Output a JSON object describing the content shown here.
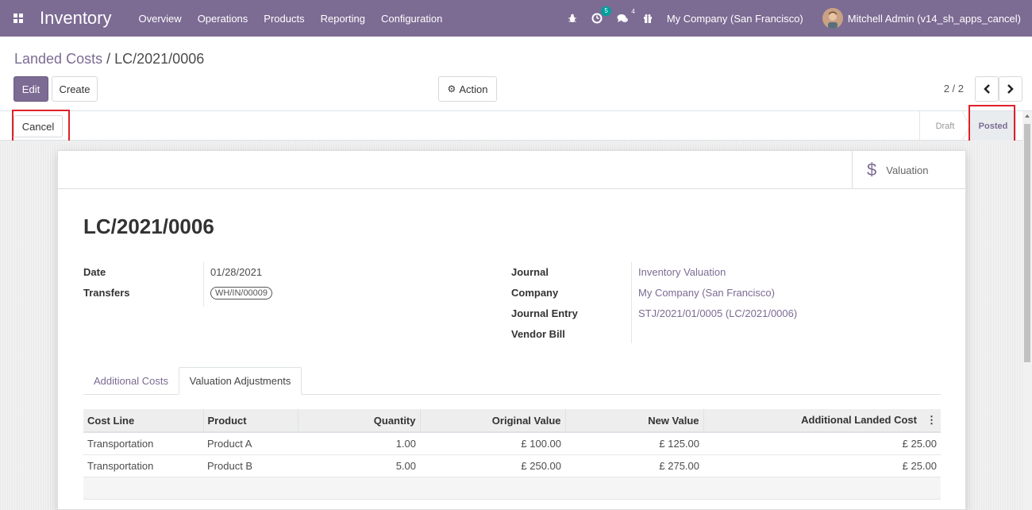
{
  "navbar": {
    "app_name": "Inventory",
    "menu": [
      "Overview",
      "Operations",
      "Products",
      "Reporting",
      "Configuration"
    ],
    "activity_count": "5",
    "messages_count": "4",
    "company": "My Company (San Francisco)",
    "user": "Mitchell Admin (v14_sh_apps_cancel)",
    "color": "#7c6b93"
  },
  "control_panel": {
    "breadcrumb_parent": "Landed Costs",
    "breadcrumb_sep": "/",
    "breadcrumb_current": "LC/2021/0006",
    "edit_label": "Edit",
    "create_label": "Create",
    "action_label": "Action",
    "pager_value": "2 / 2"
  },
  "statusbar": {
    "cancel_label": "Cancel",
    "stages": [
      "Draft",
      "Posted"
    ],
    "current_stage": "Posted"
  },
  "sheet": {
    "smart_button_label": "Valuation",
    "title": "LC/2021/0006",
    "left_fields": {
      "date_label": "Date",
      "date_value": "01/28/2021",
      "transfers_label": "Transfers",
      "transfers_value": "WH/IN/00009"
    },
    "right_fields": {
      "journal_label": "Journal",
      "journal_value": "Inventory Valuation",
      "company_label": "Company",
      "company_value": "My Company (San Francisco)",
      "journal_entry_label": "Journal Entry",
      "journal_entry_value": "STJ/2021/01/0005 (LC/2021/0006)",
      "vendor_bill_label": "Vendor Bill",
      "vendor_bill_value": ""
    },
    "tabs": [
      "Additional Costs",
      "Valuation Adjustments"
    ],
    "active_tab": "Valuation Adjustments"
  },
  "table": {
    "headers": [
      "Cost Line",
      "Product",
      "Quantity",
      "Original Value",
      "New Value",
      "Additional Landed Cost"
    ],
    "rows": [
      [
        "Transportation",
        "Product A",
        "1.00",
        "£ 100.00",
        "£ 125.00",
        "£ 25.00"
      ],
      [
        "Transportation",
        "Product B",
        "5.00",
        "£ 250.00",
        "£ 275.00",
        "£ 25.00"
      ]
    ]
  }
}
